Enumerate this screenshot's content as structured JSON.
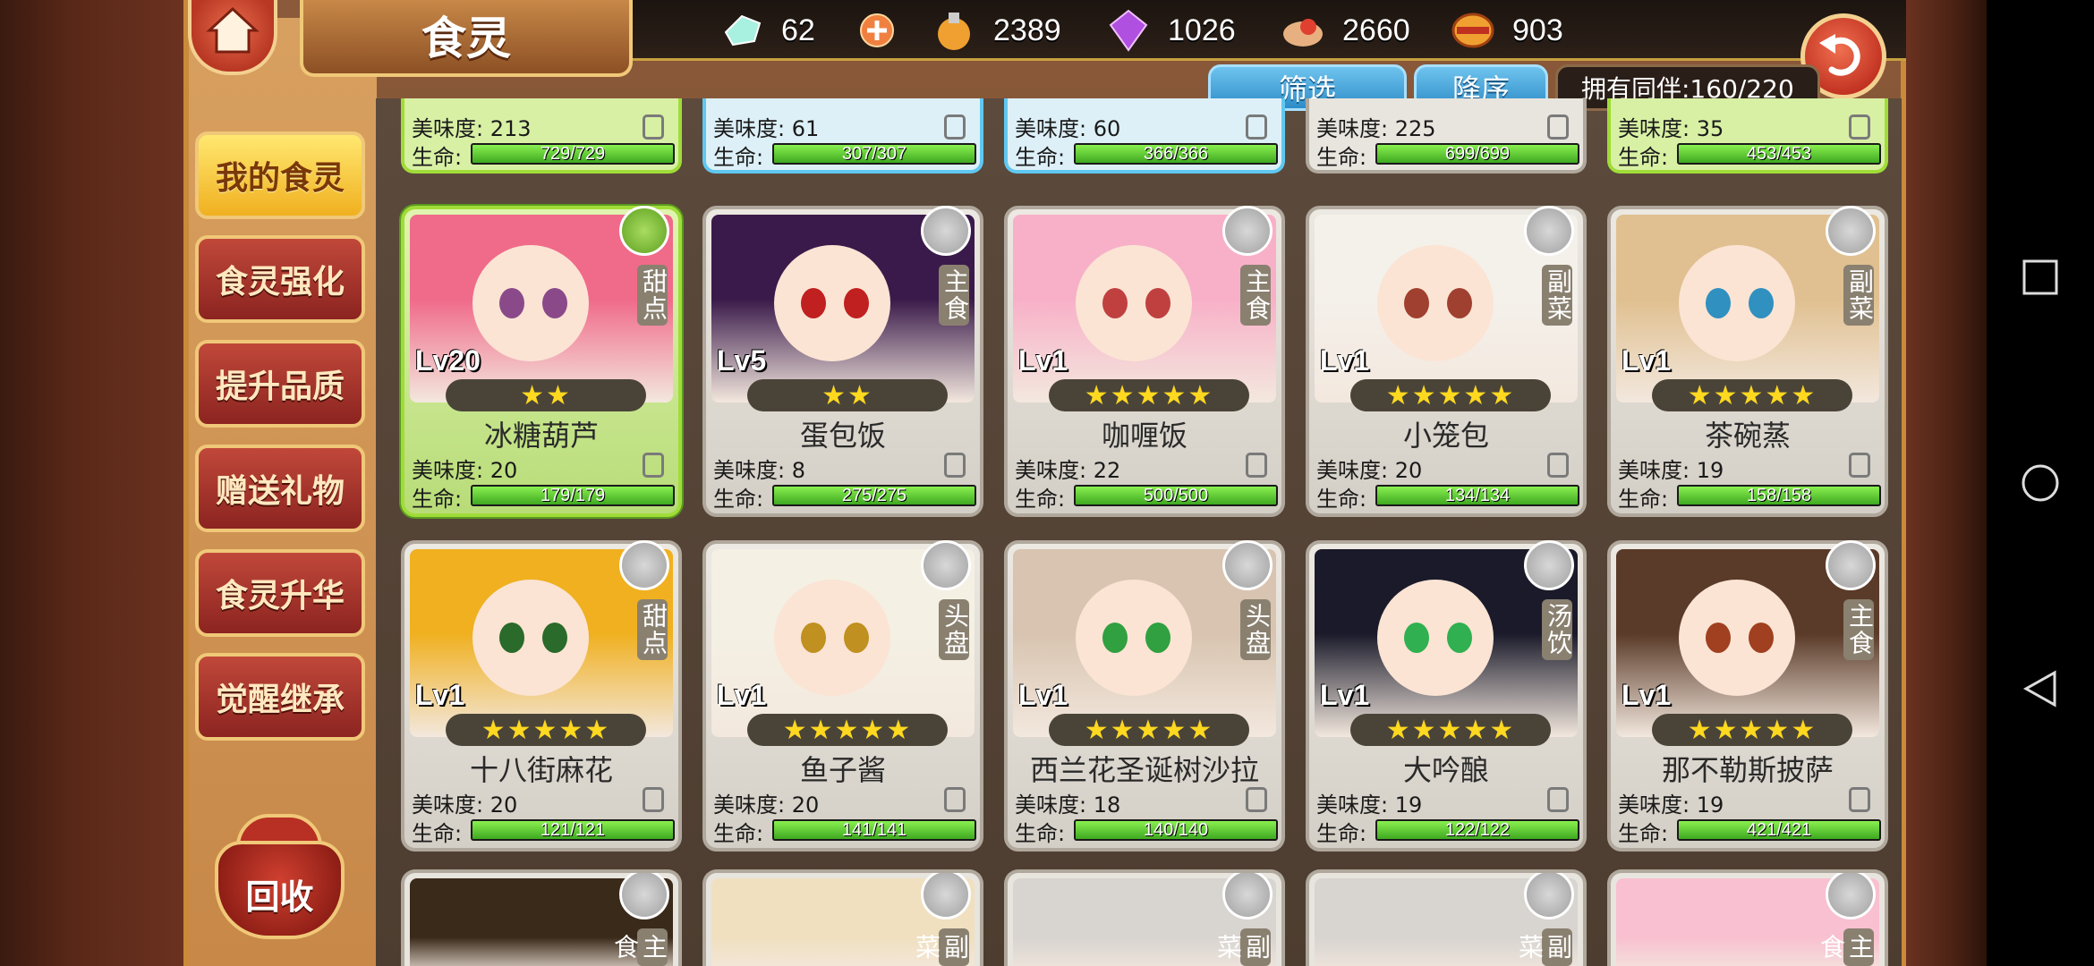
{
  "screen": {
    "title": "食灵"
  },
  "resources": [
    {
      "icon": "crystal-icon",
      "value": "62"
    },
    {
      "icon": "potion-icon",
      "value": "2389"
    },
    {
      "icon": "gem-icon",
      "value": "1026"
    },
    {
      "icon": "food-icon",
      "value": "2660"
    },
    {
      "icon": "coin-icon",
      "value": "903"
    }
  ],
  "filters": {
    "filter_label": "筛选",
    "sort_label": "降序",
    "owned_label": "拥有同伴:160/220"
  },
  "sidebar": {
    "items": [
      {
        "label": "我的食灵",
        "active": true
      },
      {
        "label": "食灵强化"
      },
      {
        "label": "提升品质"
      },
      {
        "label": "赠送礼物"
      },
      {
        "label": "食灵升华"
      },
      {
        "label": "觉醒继承"
      }
    ],
    "recycle_label": "回收"
  },
  "labels": {
    "taste": "美味度:",
    "life": "生命:"
  },
  "top_row": [
    {
      "taste": "213",
      "hp": "729/729",
      "variant": "green"
    },
    {
      "taste": "61",
      "hp": "307/307",
      "variant": "blue"
    },
    {
      "taste": "60",
      "hp": "366/366",
      "variant": "blue"
    },
    {
      "taste": "225",
      "hp": "699/699",
      "variant": "plain"
    },
    {
      "taste": "35",
      "hp": "453/453",
      "variant": "green"
    }
  ],
  "cards": [
    {
      "name": "冰糖葫芦",
      "level": "Lv20",
      "type": "甜点",
      "stars": "★★",
      "taste": "20",
      "hp": "179/179",
      "variant": "green",
      "hair": "#f06a8a",
      "eye": "#8a4a8a"
    },
    {
      "name": "蛋包饭",
      "level": "Lv5",
      "type": "主食",
      "stars": "★★",
      "taste": "8",
      "hp": "275/275",
      "variant": "plain",
      "hair": "#3a1a4a",
      "eye": "#c02020"
    },
    {
      "name": "咖喱饭",
      "level": "Lv1",
      "type": "主食",
      "stars": "★★★★★",
      "taste": "22",
      "hp": "500/500",
      "variant": "plain",
      "hair": "#f8b0c8",
      "eye": "#c04040"
    },
    {
      "name": "小笼包",
      "level": "Lv1",
      "type": "副菜",
      "stars": "★★★★★",
      "taste": "20",
      "hp": "134/134",
      "variant": "plain",
      "hair": "#f4f0ea",
      "eye": "#a04030"
    },
    {
      "name": "茶碗蒸",
      "level": "Lv1",
      "type": "副菜",
      "stars": "★★★★★",
      "taste": "19",
      "hp": "158/158",
      "variant": "plain",
      "hair": "#e0c090",
      "eye": "#3090c0"
    },
    {
      "name": "十八街麻花",
      "level": "Lv1",
      "type": "甜点",
      "stars": "★★★★★",
      "taste": "20",
      "hp": "121/121",
      "variant": "plain",
      "hair": "#f0b020",
      "eye": "#2a6a2a"
    },
    {
      "name": "鱼子酱",
      "level": "Lv1",
      "type": "头盘",
      "stars": "★★★★★",
      "taste": "20",
      "hp": "141/141",
      "variant": "plain",
      "hair": "#f4f0e4",
      "eye": "#c09020"
    },
    {
      "name": "西兰花圣诞树沙拉",
      "level": "Lv1",
      "type": "头盘",
      "stars": "★★★★★",
      "taste": "18",
      "hp": "140/140",
      "variant": "plain",
      "hair": "#d8c4b0",
      "eye": "#30a040"
    },
    {
      "name": "大吟酿",
      "level": "Lv1",
      "type": "汤饮",
      "stars": "★★★★★",
      "taste": "19",
      "hp": "122/122",
      "variant": "plain",
      "hair": "#1a1a2a",
      "eye": "#30b050"
    },
    {
      "name": "那不勒斯披萨",
      "level": "Lv1",
      "type": "主食",
      "stars": "★★★★★",
      "taste": "19",
      "hp": "421/421",
      "variant": "plain",
      "hair": "#5a3a28",
      "eye": "#a04020"
    }
  ],
  "bottom_row": [
    {
      "type": "主食",
      "hair": "#3a2a1a"
    },
    {
      "type": "副菜",
      "hair": "#f0e0c0"
    },
    {
      "type": "副菜",
      "hair": "#d8d4d0"
    },
    {
      "type": "副菜",
      "hair": "#d8d4d0"
    },
    {
      "type": "主食",
      "hair": "#f8c0d0"
    }
  ]
}
